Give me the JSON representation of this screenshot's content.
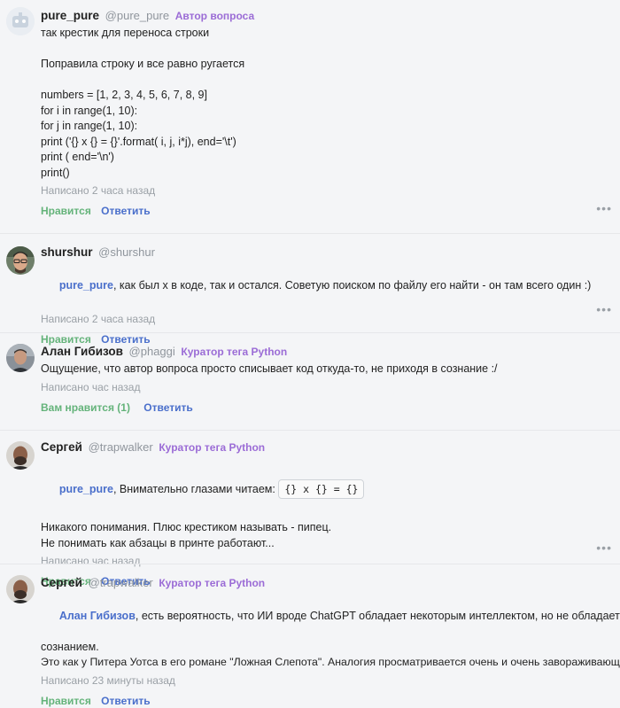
{
  "comments": [
    {
      "author": "pure_pure",
      "nick": "@pure_pure",
      "badge": "Автор вопроса",
      "lines": [
        "так крестик для переноса строки",
        "",
        "Поправила строку и все равно ругается",
        "",
        "numbers = [1, 2, 3, 4, 5, 6, 7, 8, 9]",
        "for i in range(1, 10):",
        "for j in range(1, 10):",
        "print ('{} x {} = {}'.format( i, j, i*j), end='\\t')",
        "print ( end='\\n')",
        "print()"
      ],
      "date": "Написано 2 часа назад",
      "like": "Нравится",
      "reply": "Ответить"
    },
    {
      "author": "shurshur",
      "nick": "@shurshur",
      "mention": "pure_pure",
      "text": ", как был х в коде, так и остался. Советую поиском по файлу его найти - он там всего один :)",
      "date": "Написано 2 часа назад",
      "like": "Нравится",
      "reply": "Ответить"
    },
    {
      "author": "Алан Гибизов",
      "nick": "@phaggi",
      "badge": "Куратор тега Python",
      "text": "Ощущение, что автор вопроса просто списывает код откуда-то, не приходя в сознание :/",
      "date": "Написано час назад",
      "like": "Вам нравится (1)",
      "reply": "Ответить"
    },
    {
      "author": "Сергей",
      "nick": "@trapwalker",
      "badge": "Куратор тега Python",
      "mention": "pure_pure",
      "text": ", Внимательно глазами читаем: ",
      "code": "{} x {} = {}",
      "lines": [
        "Никакого понимания. Плюс крестиком называть - пипец.",
        "Не понимать как абзацы в принте работают..."
      ],
      "date": "Написано час назад",
      "like": "Нравится",
      "reply": "Ответить"
    },
    {
      "author": "Сергей",
      "nick": "@trapwalker",
      "badge": "Куратор тега Python",
      "mention": "Алан Гибизов",
      "text": ", есть вероятность, что ИИ вроде ChatGPT обладает некоторым интеллектом, но не обладает",
      "lines": [
        "сознанием.",
        "Это как у Питера Уотса в его романе \"Ложная Слепота\". Аналогия просматривается очень и очень завораживающая."
      ],
      "date": "Написано 23 минуты назад",
      "like": "Нравится",
      "reply": "Ответить"
    }
  ],
  "more_icon": "•••",
  "colors": {
    "mention": "#4a6fcb",
    "badge": "#9b6cd6",
    "like": "#64b37a",
    "meta": "#9aa0a6"
  }
}
